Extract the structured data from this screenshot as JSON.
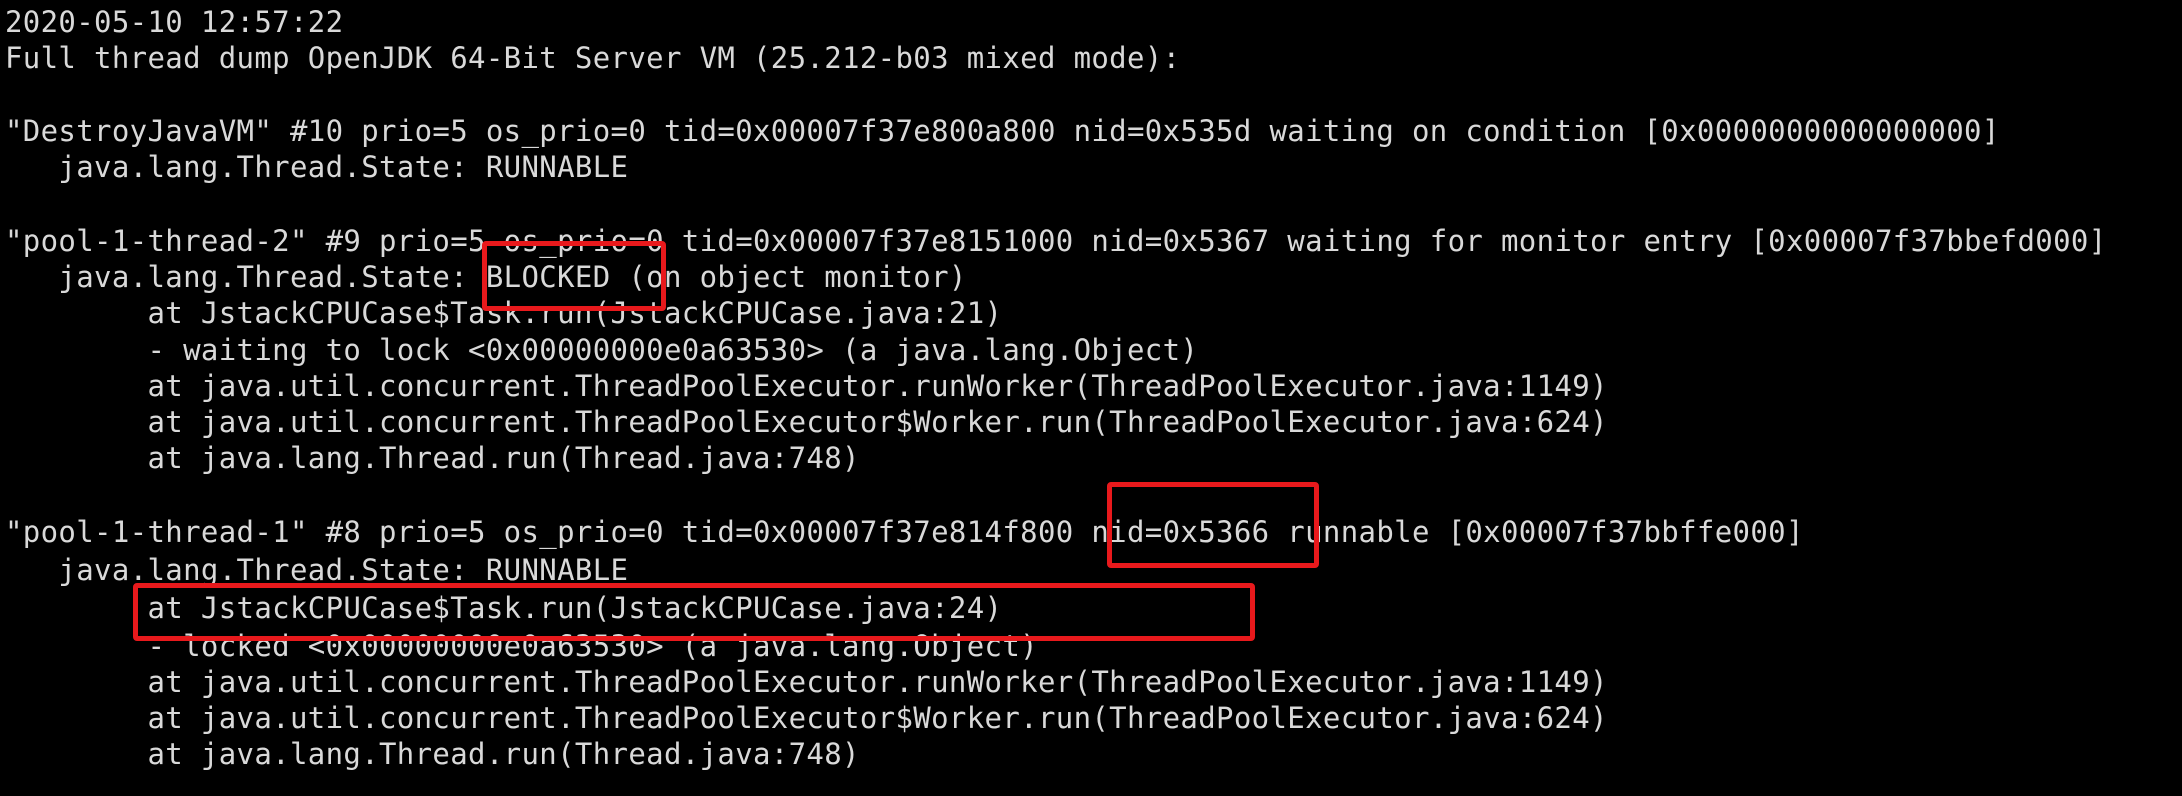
{
  "colors": {
    "background": "#000000",
    "text": "#d9d9d9",
    "highlight": "#e8191c"
  },
  "terminal": {
    "lines": [
      "2020-05-10 12:57:22",
      "Full thread dump OpenJDK 64-Bit Server VM (25.212-b03 mixed mode):",
      "\"DestroyJavaVM\" #10 prio=5 os_prio=0 tid=0x00007f37e800a800 nid=0x535d waiting on condition [0x0000000000000000]",
      "   java.lang.Thread.State: RUNNABLE",
      "\"pool-1-thread-2\" #9 prio=5 os_prio=0 tid=0x00007f37e8151000 nid=0x5367 waiting for monitor entry [0x00007f37bbefd000]",
      "   java.lang.Thread.State: BLOCKED (on object monitor)",
      "        at JstackCPUCase$Task.run(JstackCPUCase.java:21)",
      "        - waiting to lock <0x00000000e0a63530> (a java.lang.Object)",
      "        at java.util.concurrent.ThreadPoolExecutor.runWorker(ThreadPoolExecutor.java:1149)",
      "        at java.util.concurrent.ThreadPoolExecutor$Worker.run(ThreadPoolExecutor.java:624)",
      "        at java.lang.Thread.run(Thread.java:748)",
      "\"pool-1-thread-1\" #8 prio=5 os_prio=0 tid=0x00007f37e814f800 nid=0x5366 runnable [0x00007f37bbffe000]",
      "   java.lang.Thread.State: RUNNABLE",
      "        at JstackCPUCase$Task.run(JstackCPUCase.java:24)",
      "        - locked <0x00000000e0a63530> (a java.lang.Object)",
      "        at java.util.concurrent.ThreadPoolExecutor.runWorker(ThreadPoolExecutor.java:1149)",
      "        at java.util.concurrent.ThreadPoolExecutor$Worker.run(ThreadPoolExecutor.java:624)",
      "        at java.lang.Thread.run(Thread.java:748)"
    ]
  }
}
